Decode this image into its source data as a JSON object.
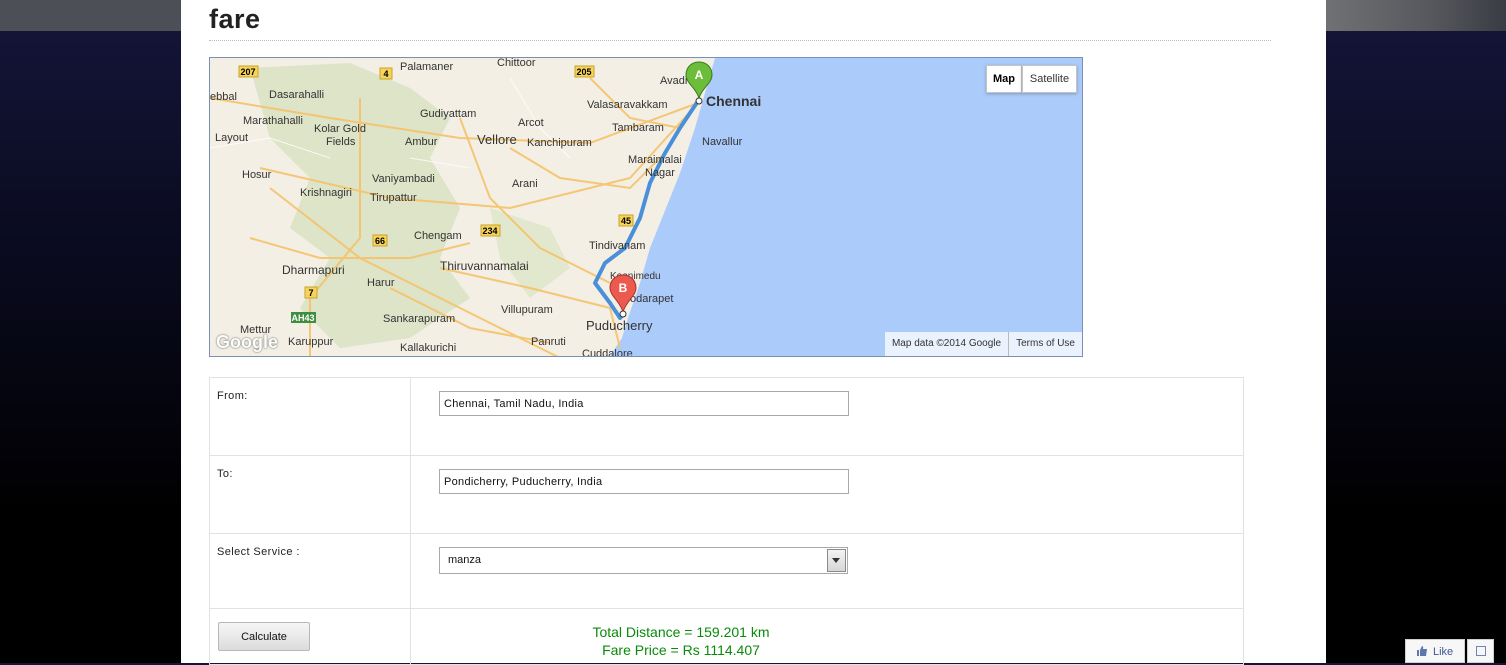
{
  "page": {
    "title": "fare"
  },
  "map": {
    "type_buttons": {
      "map": "Map",
      "satellite": "Satellite"
    },
    "attribution": "Map data ©2014 Google",
    "terms": "Terms of Use",
    "logo": "Google",
    "marker_a": "A",
    "marker_b": "B",
    "labels": {
      "chennai": "Chennai",
      "avadi": "Avadi",
      "valasaravakkam": "Valasaravakkam",
      "tambaram": "Tambaram",
      "navallur": "Navallur",
      "maraimalai": "Maraimalai",
      "nagar": "Nagar",
      "palamaner": "Palamaner",
      "chittoor": "Chittoor",
      "dasarahalli": "Dasarahalli",
      "gudiyattam": "Gudiyattam",
      "marathahalli": "Marathahalli",
      "kolar_gold": "Kolar Gold",
      "fields": "Fields",
      "arcot": "Arcot",
      "vellore": "Vellore",
      "ambur": "Ambur",
      "kanchipuram": "Kanchipuram",
      "layout": "Layout",
      "bbal": "ebbal",
      "hosur": "Hosur",
      "vaniyambadi": "Vaniyambadi",
      "krishnagiri": "Krishnagiri",
      "tirupattur": "Tirupattur",
      "arani": "Arani",
      "chengam": "Chengam",
      "tindivanam": "Tindivanam",
      "dharmapuri": "Dharmapuri",
      "thiruvannamalai": "Thiruvannamalai",
      "harur": "Harur",
      "koonimedu": "Koonimedu",
      "kodarapet": "odarapet",
      "mettur": "Mettur",
      "sankarapuram": "Sankarapuram",
      "villupuram": "Villupuram",
      "puducherry": "Puducherry",
      "karuppur": "Karuppur",
      "kallakurichi": "Kallakurichi",
      "panruti": "Panruti",
      "cuddalore": "Cuddalore"
    },
    "shields": [
      "207",
      "4",
      "205",
      "45",
      "66",
      "234",
      "7",
      "AH43"
    ]
  },
  "form": {
    "from": {
      "label": "From:",
      "value": "Chennai, Tamil Nadu, India"
    },
    "to": {
      "label": "To:",
      "value": "Pondicherry, Puducherry, India"
    },
    "service": {
      "label": "Select Service :",
      "value": "manza"
    },
    "calculate_label": "Calculate",
    "result": {
      "distance": "Total Distance = 159.201 km",
      "fare": "Fare Price = Rs 1114.407"
    }
  },
  "like_widget": {
    "label": "Like"
  },
  "colors": {
    "result_text": "#0a8a0a",
    "route": "#4a90d9",
    "sea": "#abcbfb",
    "land": "#f3efe4"
  }
}
